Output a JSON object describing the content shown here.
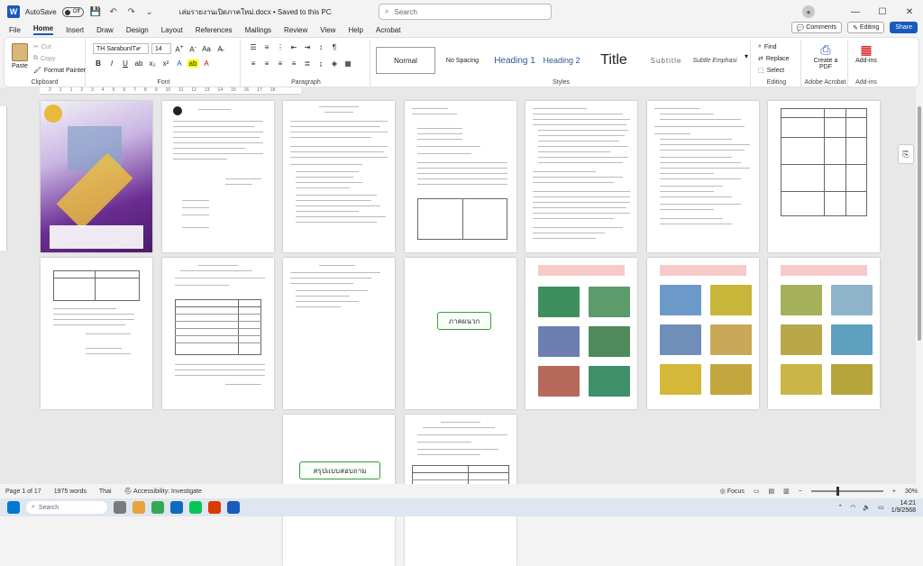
{
  "titlebar": {
    "autosave_label": "AutoSave",
    "autosave_state": "Off",
    "doc_title": "เล่มรายงานเปิดภาคใหม่.docx • Saved to this PC",
    "search_placeholder": "Search"
  },
  "menu": {
    "items": [
      "File",
      "Home",
      "Insert",
      "Draw",
      "Design",
      "Layout",
      "References",
      "Mailings",
      "Review",
      "View",
      "Help",
      "Acrobat"
    ],
    "comments": "Comments",
    "editing": "Editing",
    "share": "Share"
  },
  "ribbon": {
    "clipboard": {
      "paste": "Paste",
      "cut": "Cut",
      "copy": "Copy",
      "format_painter": "Format Painter",
      "label": "Clipboard"
    },
    "font": {
      "name": "TH SarabunIT๙",
      "size": "14",
      "label": "Font"
    },
    "paragraph": {
      "label": "Paragraph"
    },
    "styles": {
      "items": [
        "Normal",
        "No Spacing",
        "Heading 1",
        "Heading 2",
        "Title",
        "Subtitle",
        "Subtle Emphasi"
      ],
      "label": "Styles"
    },
    "editing": {
      "find": "Find",
      "replace": "Replace",
      "select": "Select",
      "label": "Editing"
    },
    "acrobat": {
      "create_pdf": "Create a PDF",
      "label": "Adobe Acrobat"
    },
    "addins": {
      "button": "Add-ins",
      "label": "Add-ins"
    }
  },
  "pages": {
    "appendix_label": "ภาคผนวก",
    "summary_label": "สรุปแบบสอบถาม"
  },
  "status": {
    "page": "Page 1 of 17",
    "words": "1975 words",
    "language": "Thai",
    "accessibility": "Accessibility: Investigate",
    "focus": "Focus",
    "zoom": "30%"
  },
  "taskbar": {
    "search": "Search",
    "time": "14:21",
    "date": "1/9/2568"
  },
  "colors": {
    "accent": "#185abd"
  }
}
